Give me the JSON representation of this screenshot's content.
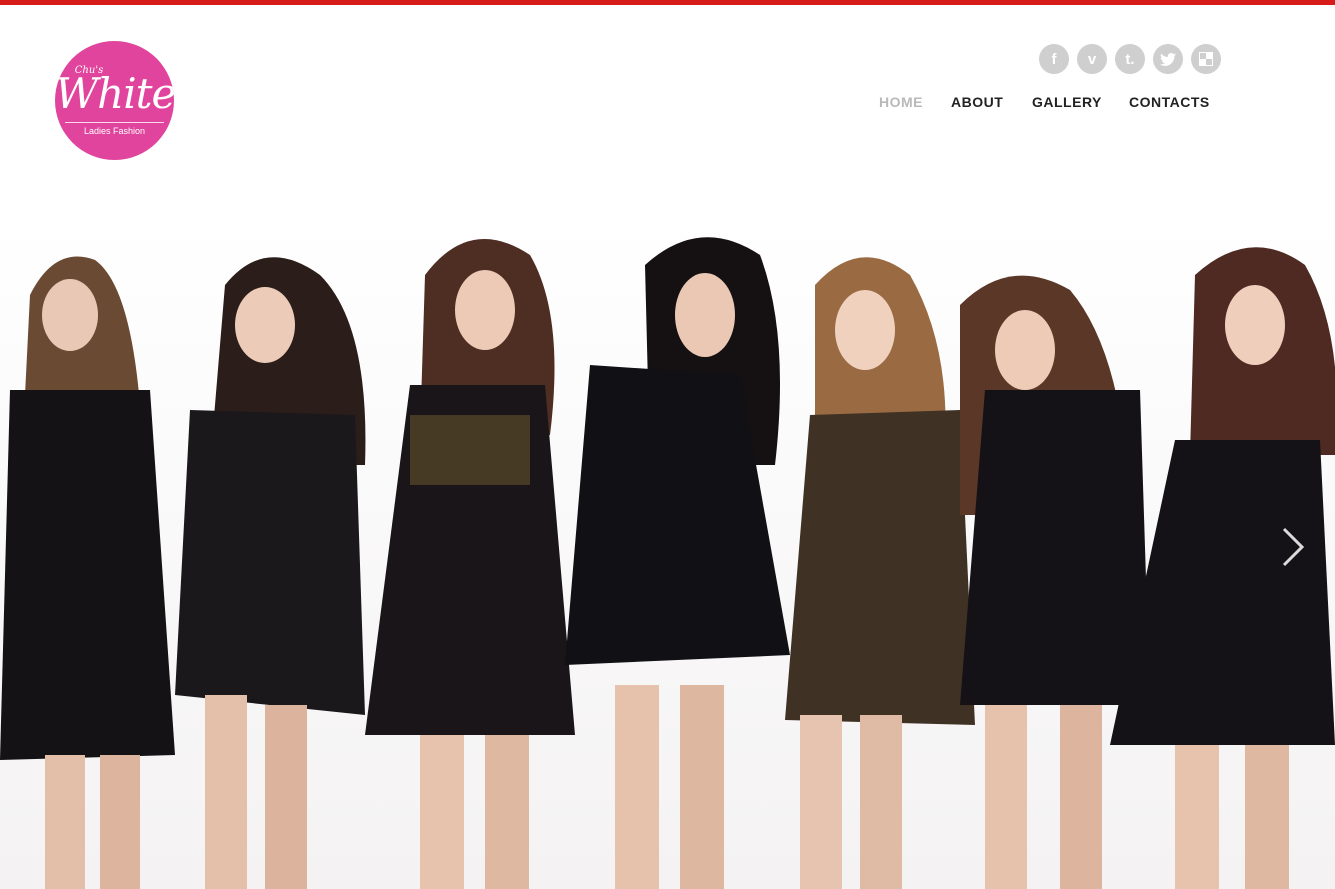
{
  "colors": {
    "top_bar": "#d71a1a",
    "logo_pink": "#e0449d",
    "nav_active": "#b9b9b9",
    "nav_text": "#222222",
    "social_bg": "#cfcfcf"
  },
  "logo": {
    "prefix": "Chu's",
    "word": "White",
    "tagline": "Ladies Fashion"
  },
  "social": [
    {
      "name": "facebook-icon",
      "glyph": "f"
    },
    {
      "name": "vimeo-icon",
      "glyph": "v"
    },
    {
      "name": "tumblr-icon",
      "glyph": "t."
    },
    {
      "name": "twitter-icon",
      "glyph": ""
    },
    {
      "name": "delicious-icon",
      "glyph": ""
    }
  ],
  "nav": [
    {
      "label": "HOME",
      "active": true
    },
    {
      "label": "ABOUT",
      "active": false
    },
    {
      "label": "GALLERY",
      "active": false
    },
    {
      "label": "CONTACTS",
      "active": false
    }
  ],
  "hero": {
    "image": "group-photo",
    "next_icon": "chevron-right-icon"
  }
}
